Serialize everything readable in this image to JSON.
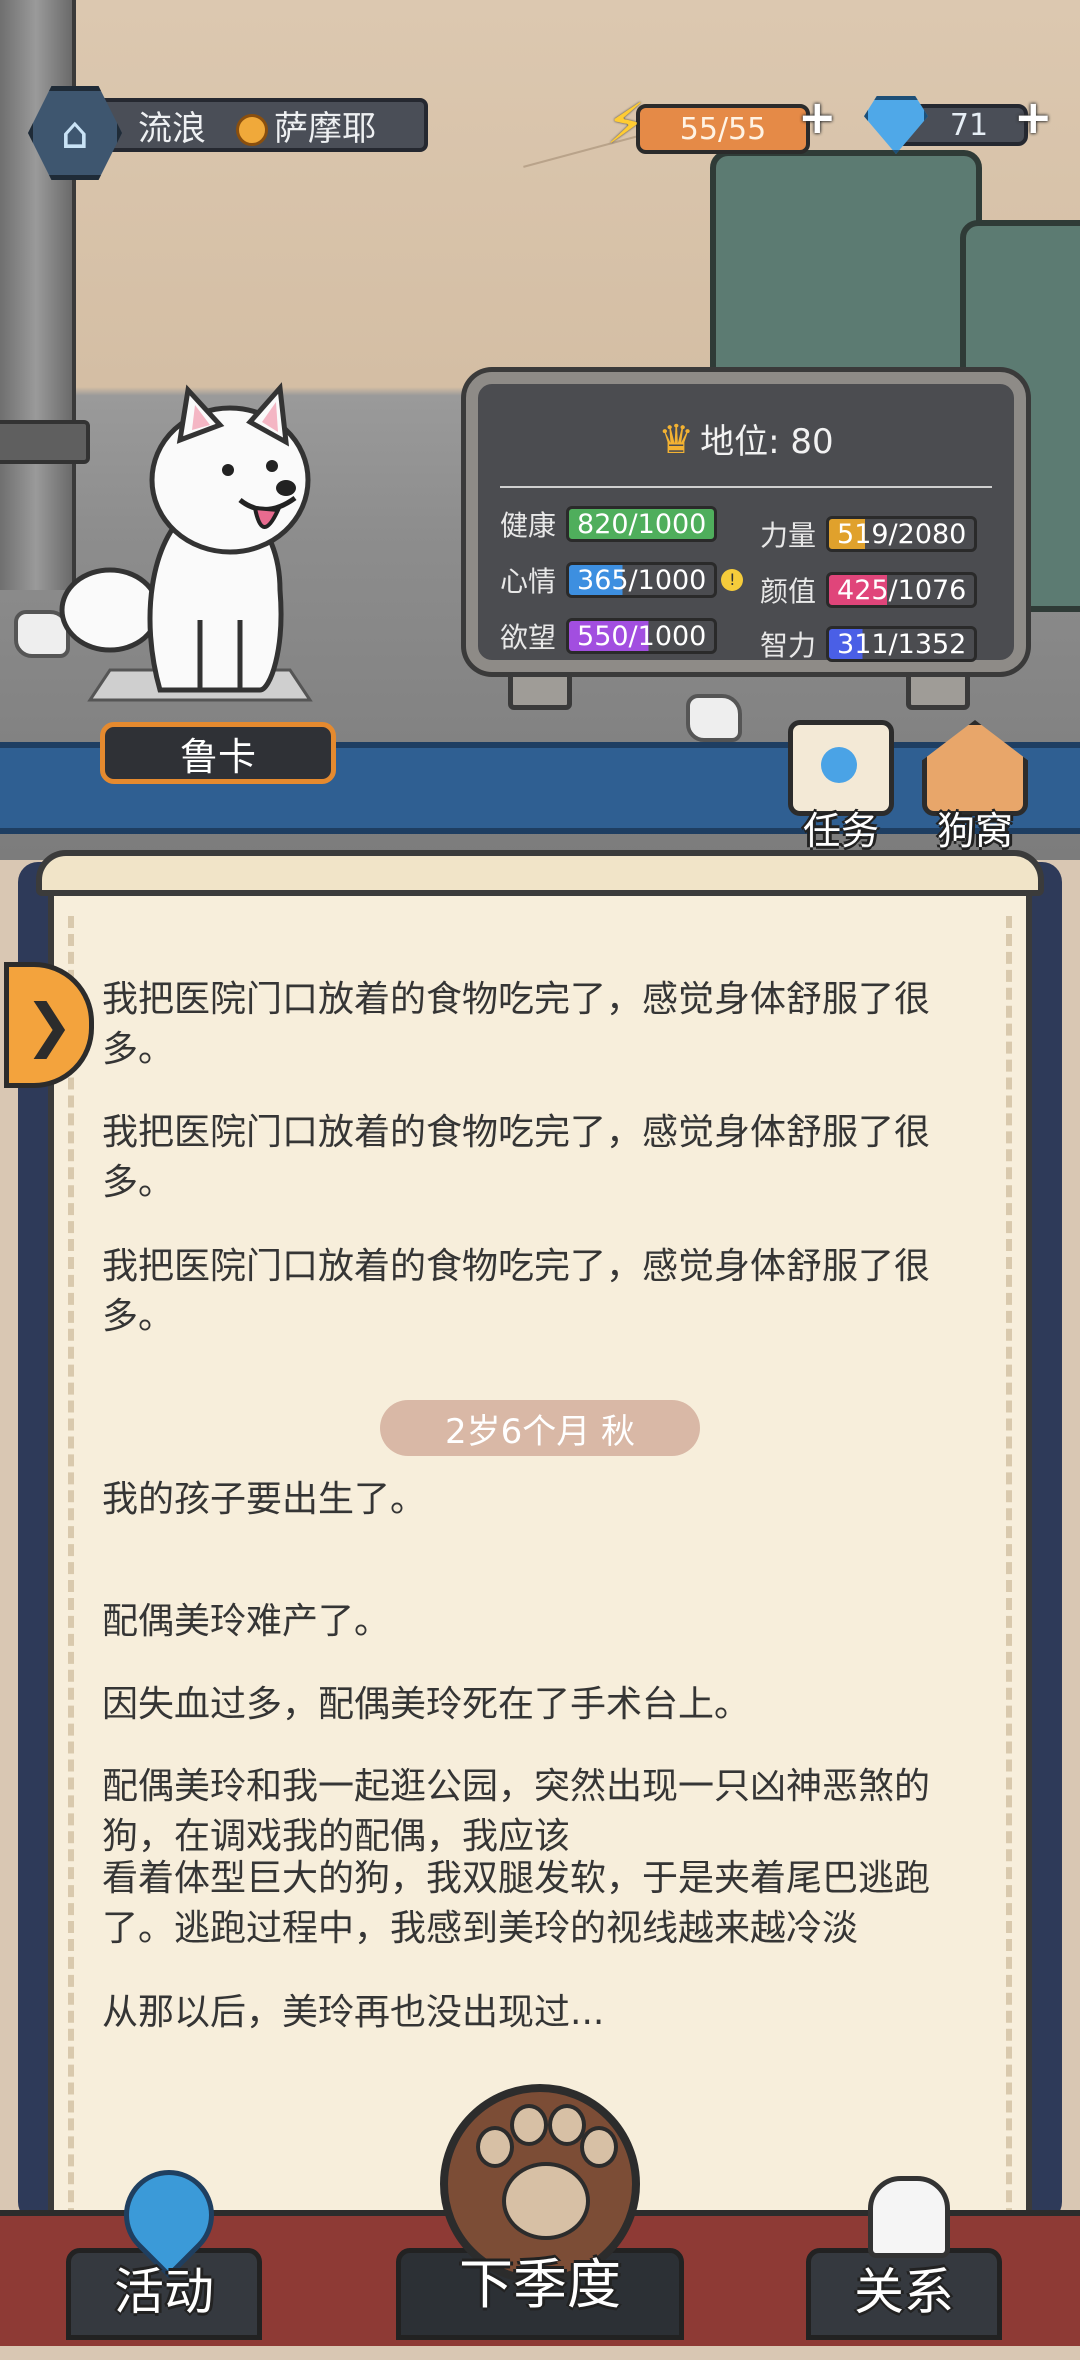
{
  "header": {
    "status": "流浪",
    "breed": "萨摩耶",
    "energy": "55/55",
    "gems": "71"
  },
  "dog": {
    "name": "鲁卡"
  },
  "stats": {
    "status_label": "地位: 80",
    "health_label": "健康",
    "health_value": "820/1000",
    "strength_label": "力量",
    "strength_value": "519/2080",
    "mood_label": "心情",
    "mood_value": "365/1000",
    "looks_label": "颜值",
    "looks_value": "425/1076",
    "desire_label": "欲望",
    "desire_value": "550/1000",
    "intellect_label": "智力",
    "intellect_value": "311/1352"
  },
  "side_buttons": {
    "tasks": "任务",
    "kennel": "狗窝"
  },
  "log": {
    "entries_before": [
      "我把医院门口放着的食物吃完了，感觉身体舒服了很多。",
      "我把医院门口放着的食物吃完了，感觉身体舒服了很多。",
      "我把医院门口放着的食物吃完了，感觉身体舒服了很多。"
    ],
    "date_label": "2岁6个月 秋",
    "entries_after": [
      "我的孩子要出生了。",
      "配偶美玲难产了。",
      "因失血过多，配偶美玲死在了手术台上。",
      "配偶美玲和我一起逛公园，突然出现一只凶神恶煞的狗，在调戏我的配偶，我应该",
      "看着体型巨大的狗，我双腿发软，于是夹着尾巴逃跑了。逃跑过程中，我感到美玲的视线越来越冷淡",
      "从那以后，美玲再也没出现过..."
    ]
  },
  "bottom_nav": {
    "activity": "活动",
    "next_season": "下季度",
    "relations": "关系"
  },
  "colors": {
    "health": "#4fae5c",
    "strength": "#e0a12c",
    "mood": "#3d8fe0",
    "looks": "#e0457a",
    "desire": "#a24ee0",
    "intellect": "#4a5fe6"
  }
}
